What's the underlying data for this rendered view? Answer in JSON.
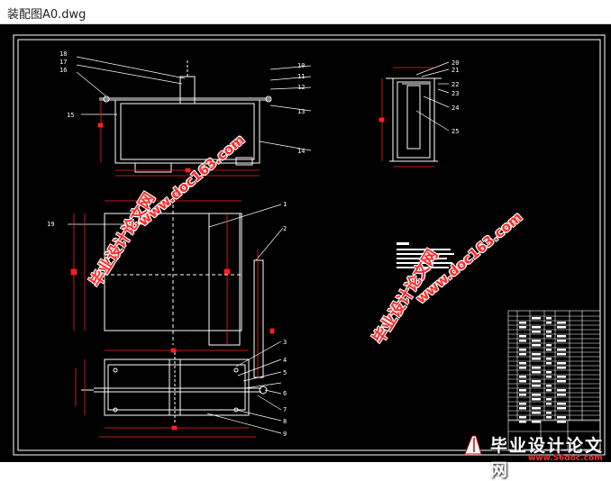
{
  "window": {
    "title": "装配图A0.dwg"
  },
  "part_labels": {
    "p1": "1",
    "p2": "2",
    "p3": "3",
    "p4": "4",
    "p5": "5",
    "p6": "6",
    "p7": "7",
    "p8": "8",
    "p9": "9",
    "p10": "10",
    "p11": "11",
    "p12": "12",
    "p13": "13",
    "p14": "14",
    "p15": "15",
    "p16": "16",
    "p17": "17",
    "p18": "18",
    "p19": "19",
    "p20": "20",
    "p21": "21",
    "p22": "22",
    "p23": "23",
    "p24": "24",
    "p25": "25"
  },
  "watermarks": {
    "cn": "毕业设计论文网",
    "url": "www.doc163.com"
  },
  "logo": {
    "text": "毕业设计论文网",
    "url": "www.56doc.com"
  },
  "colors": {
    "background": "#000000",
    "line": "#ffffff",
    "dimension": "#ff2020",
    "watermark": "#ff2a2a"
  }
}
